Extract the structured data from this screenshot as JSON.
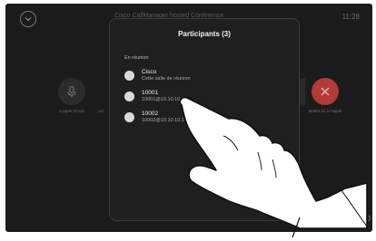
{
  "background": {
    "title": "Cisco CallManager hosted Conference",
    "time": "11:28",
    "mute_label": "Couper le son",
    "partial_label": "Ad",
    "end_label": "Mettre fin à l'appel"
  },
  "participants": {
    "title": "Participants (3)",
    "section_label": "En réunion",
    "items": [
      {
        "name": "Cisco",
        "detail": "Cette salle de réunion"
      },
      {
        "name": "10001",
        "detail": "10001@10.10.10.14"
      },
      {
        "name": "10002",
        "detail": "10002@10.10.10.14"
      }
    ]
  },
  "icons": [
    "collapse-icon",
    "microphone-icon",
    "end-call-icon",
    "volume-icon",
    "hand-pointer-icon"
  ]
}
